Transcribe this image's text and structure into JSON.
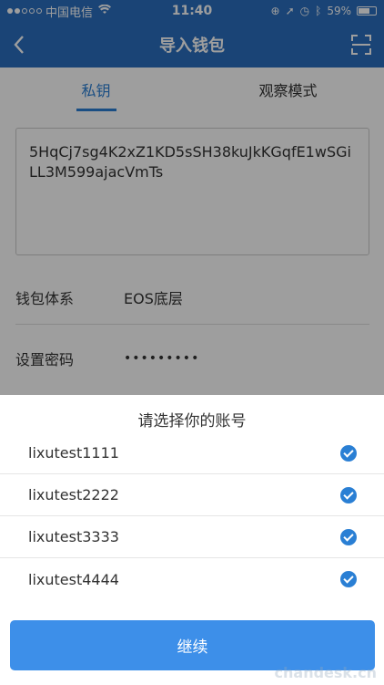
{
  "status_bar": {
    "carrier": "中国电信",
    "time": "11:40",
    "battery": "59%",
    "battery_level": 0.59,
    "signal_filled": 2,
    "signal_total": 5
  },
  "nav": {
    "title": "导入钱包",
    "back_icon": "chevron-left-icon",
    "scan_icon": "scan-icon"
  },
  "tabs": [
    {
      "label": "私钥",
      "active": true
    },
    {
      "label": "观察模式",
      "active": false
    }
  ],
  "private_key": "5HqCj7sg4K2xZ1KD5sSH38kuJkKGqfE1wSGiLL3M599ajacVmTs",
  "wallet_system": {
    "label": "钱包体系",
    "value": "EOS底层"
  },
  "password": {
    "label": "设置密码",
    "value": "•••••••••"
  },
  "sheet": {
    "title": "请选择你的账号",
    "accounts": [
      {
        "name": "lixutest1111",
        "checked": true
      },
      {
        "name": "lixutest2222",
        "checked": true
      },
      {
        "name": "lixutest3333",
        "checked": true
      },
      {
        "name": "lixutest4444",
        "checked": true
      }
    ],
    "continue_label": "继续"
  },
  "watermark": "chandesk.cn",
  "colors": {
    "primary": "#2a6fbf",
    "accent": "#2a7fd4",
    "button": "#3d8fe9"
  }
}
